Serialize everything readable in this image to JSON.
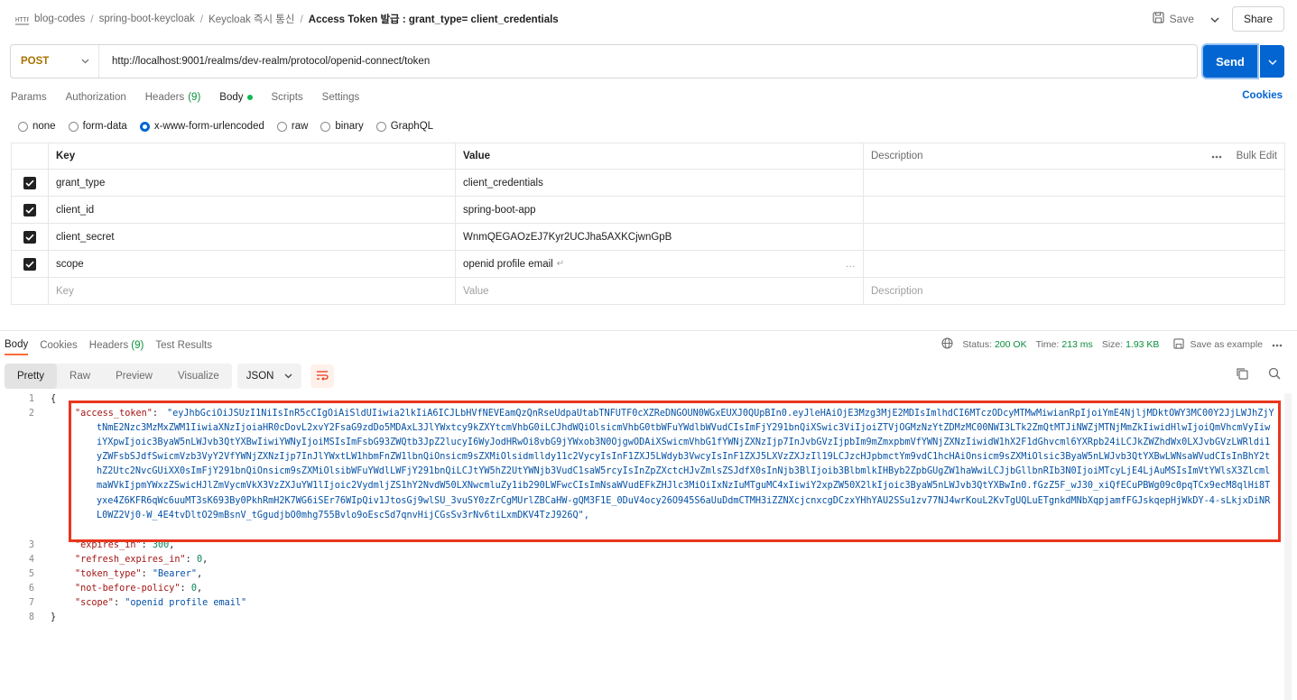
{
  "breadcrumb": {
    "items": [
      "blog-codes",
      "spring-boot-keycloak",
      "Keycloak 즉시 통신"
    ],
    "active": "Access Token 발급 : grant_type= client_credentials"
  },
  "toolbar": {
    "save_label": "Save",
    "share_label": "Share"
  },
  "request": {
    "method": "POST",
    "url": "http://localhost:9001/realms/dev-realm/protocol/openid-connect/token",
    "send_label": "Send"
  },
  "request_tabs": {
    "params": "Params",
    "authorization": "Authorization",
    "headers": "Headers",
    "headers_count": "(9)",
    "body": "Body",
    "scripts": "Scripts",
    "settings": "Settings",
    "cookies": "Cookies"
  },
  "body_types": [
    "none",
    "form-data",
    "x-www-form-urlencoded",
    "raw",
    "binary",
    "GraphQL"
  ],
  "body_type_selected": "x-www-form-urlencoded",
  "params_table": {
    "headers": {
      "key": "Key",
      "value": "Value",
      "description": "Description",
      "bulk_edit": "Bulk Edit"
    },
    "rows": [
      {
        "key": "grant_type",
        "value": "client_credentials"
      },
      {
        "key": "client_id",
        "value": "spring-boot-app"
      },
      {
        "key": "client_secret",
        "value": "WnmQEGAOzEJ7Kyr2UCJha5AXKCjwnGpB"
      },
      {
        "key": "scope",
        "value": "openid profile email"
      }
    ],
    "placeholder": {
      "key": "Key",
      "value": "Value",
      "description": "Description"
    }
  },
  "response_tabs": {
    "body": "Body",
    "cookies": "Cookies",
    "headers": "Headers",
    "headers_count": "(9)",
    "test_results": "Test Results"
  },
  "response_status": {
    "status_label": "Status:",
    "status_value": "200 OK",
    "time_label": "Time:",
    "time_value": "213 ms",
    "size_label": "Size:",
    "size_value": "1.93 KB",
    "save_example": "Save as example"
  },
  "view_modes": [
    "Pretty",
    "Raw",
    "Preview",
    "Visualize"
  ],
  "view_mode_selected": "Pretty",
  "format": "JSON",
  "response_body": {
    "access_token_key": "\"access_token\"",
    "access_token_value": "\"eyJhbGciOiJSUzI1NiIsInR5cCIgOiAiSldUIiwia2lkIiA6ICJLbHVfNEVEamQzQnRseUdpaUtabTNFUTF0cXZReDNGOUN0WGxEUXJ0QUpBIn0.eyJleHAiOjE3Mzg3MjE2MDIsImlhdCI6MTczODcyMTMwMiwianRpIjoiYmE4NjljMDktOWY3MC00Y2JjLWJhZjYtNmE2Nzc3MzMxZWM1IiwiaXNzIjoiaHR0cDovL2xvY2FsaG9zdDo5MDAxL3JlYWxtcy9kZXYtcmVhbG0iLCJhdWQiOlsicmVhbG0tbWFuYWdlbWVudCIsImFjY291bnQiXSwic3ViIjoiZTVjOGMzNzYtZDMzMC00NWI3LTk2ZmQtMTJiNWZjMTNjMmZkIiwidHlwIjoiQmVhcmVyIiwiYXpwIjoic3ByaW5nLWJvb3QtYXBwIiwiYWNyIjoiMSIsImFsbG93ZWQtb3JpZ2lucyI6WyJodHRwOi8vbG9jYWxob3N0OjgwODAiXSwicmVhbG1fYWNjZXNzIjp7InJvbGVzIjpbIm9mZmxpbmVfYWNjZXNzIiwidW1hX2F1dGhvcml6YXRpb24iLCJkZWZhdWx0LXJvbGVzLWRldi1yZWFsbSJdfSwicmVzb3VyY2VfYWNjZXNzIjp7InJlYWxtLW1hbmFnZW1lbnQiOnsicm9sZXMiOlsidmlldy11c2VycyIsInF1ZXJ5LWdyb3VwcyIsInF1ZXJ5LXVzZXJzIl19LCJzcHJpbmctYm9vdC1hcHAiOnsicm9sZXMiOlsic3ByaW5nLWJvb3QtYXBwLWNsaWVudCIsInBhY2thZ2Utc2NvcGUiXX0sImFjY291bnQiOnsicm9sZXMiOlsibWFuYWdlLWFjY291bnQiLCJtYW5hZ2UtYWNjb3VudC1saW5rcyIsInZpZXctcHJvZmlsZSJdfX0sInNjb3BlIjoib3BlbmlkIHByb2ZpbGUgZW1haWwiLCJjbGllbnRIb3N0IjoiMTcyLjE4LjAuMSIsImVtYWlsX3ZlcmlmaWVkIjpmYWxzZSwicHJlZmVycmVkX3VzZXJuYW1lIjoic2VydmljZS1hY2NvdW50LXNwcmluZy1ib290LWFwcCIsImNsaWVudEFkZHJlc3MiOiIxNzIuMTguMC4xIiwiY2xpZW50X2lkIjoic3ByaW5nLWJvb3QtYXBwIn0.fGzZ5F_wJ30_xiQfECuPBWg09c0pqTCx9ecM8qlHi8Tyxe4Z6KFR6qWc6uuMT3sK693By0PkhRmH2K7WG6iSEr76WIpQiv1JtosGj9wlSU_3vuSY0zZrCgMUrlZBCaHW-gQM3F1E_0DuV4ocy26O945S6aUuDdmCTMH3iZZNXcjcnxcgDCzxYHhYAU2SSu1zv77NJ4wrKouL2KvTgUQLuETgnkdMNbXqpjamfFGJskqepHjWkDY-4-sLkjxDiNRL0WZ2Vj0-W_4E4tvDltO29mBsnV_tGgudjbO0mhg755Bvlo9oEscSd7qnvHijCGsSv3rNv6tiLxmDKV4TzJ926Q\"",
    "expires_in_key": "\"expires_in\"",
    "expires_in_value": "300",
    "refresh_expires_in_key": "\"refresh_expires_in\"",
    "refresh_expires_in_value": "0",
    "token_type_key": "\"token_type\"",
    "token_type_value": "\"Bearer\"",
    "nbp_key": "\"not-before-policy\"",
    "nbp_value": "0",
    "scope_key": "\"scope\"",
    "scope_value": "\"openid profile email\"",
    "line_numbers": [
      "1",
      "2",
      "3",
      "4",
      "5",
      "6",
      "7",
      "8"
    ]
  },
  "colors": {
    "accent": "#0265d2",
    "highlight": "#e8361d",
    "method": "#a97200",
    "status_ok": "#0a8f3c"
  }
}
